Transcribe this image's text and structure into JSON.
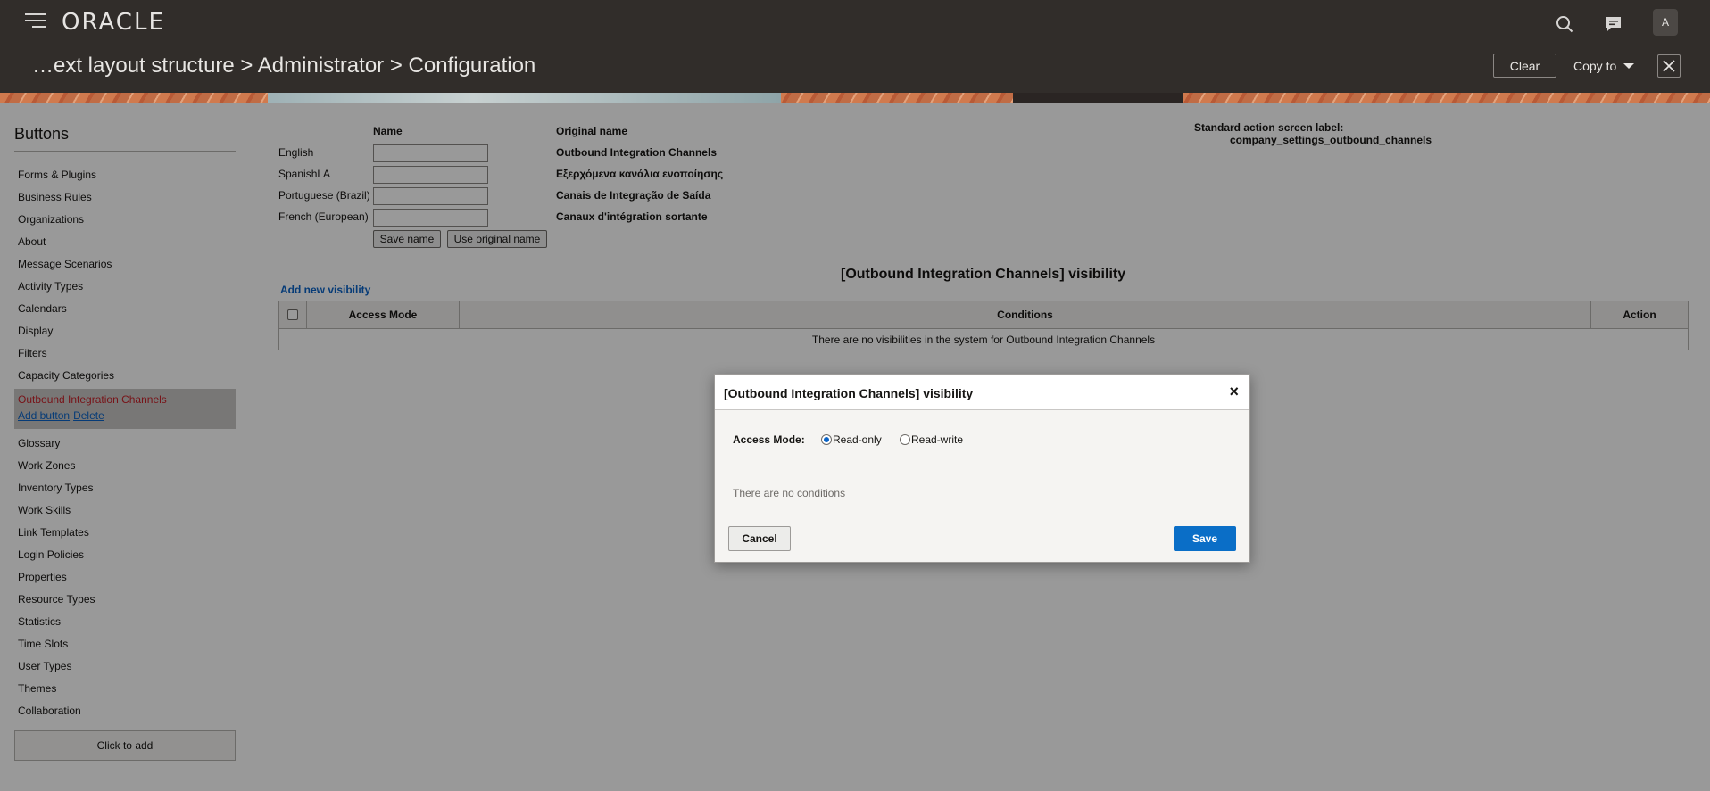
{
  "header": {
    "logo": "ORACLE",
    "breadcrumb": "…ext layout structure > Administrator > Configuration",
    "clear_label": "Clear",
    "copy_to_label": "Copy to",
    "avatar_initial": "A",
    "icons": [
      "menu-icon",
      "search-icon",
      "chat-icon",
      "close-icon"
    ]
  },
  "sidebar": {
    "title": "Buttons",
    "items_before": [
      "Forms & Plugins",
      "Business Rules",
      "Organizations",
      "About",
      "Message Scenarios",
      "Activity Types",
      "Calendars",
      "Display",
      "Filters",
      "Capacity Categories"
    ],
    "active": {
      "label": "Outbound Integration Channels",
      "add_button": "Add button",
      "delete": "Delete"
    },
    "items_after": [
      "Glossary",
      "Work Zones",
      "Inventory Types",
      "Work Skills",
      "Link Templates",
      "Login Policies",
      "Properties",
      "Resource Types",
      "Statistics",
      "Time Slots",
      "User Types",
      "Themes",
      "Collaboration"
    ],
    "click_to_add": "Click to add"
  },
  "names": {
    "name_header": "Name",
    "original_header": "Original name",
    "rows": [
      {
        "language": "English",
        "value": "",
        "original": "Outbound Integration Channels"
      },
      {
        "language": "SpanishLA",
        "value": "",
        "original": "Εξερχόμενα κανάλια ενοποίησης"
      },
      {
        "language": "Portuguese (Brazil)",
        "value": "",
        "original": "Canais de Integração de Saída"
      },
      {
        "language": "French (European)",
        "value": "",
        "original": "Canaux d'intégration sortante"
      }
    ],
    "save_name": "Save name",
    "use_original": "Use original name",
    "standard_label_caption": "Standard action screen label:",
    "standard_label_value": "company_settings_outbound_channels"
  },
  "visibility": {
    "title": "[Outbound Integration Channels] visibility",
    "add_new": "Add new visibility",
    "columns": [
      "Access Mode",
      "Conditions",
      "Action"
    ],
    "empty_message": "There are no visibilities in the system for Outbound Integration Channels"
  },
  "modal": {
    "title": "[Outbound Integration Channels] visibility",
    "access_mode_label": "Access Mode:",
    "options": [
      "Read-only",
      "Read-write"
    ],
    "selected": "Read-only",
    "no_conditions": "There are no conditions",
    "cancel": "Cancel",
    "save": "Save",
    "close_glyph": "×"
  },
  "colors": {
    "header_bg": "#312d2a",
    "active_item": "#c7222a",
    "link": "#0a63c7",
    "primary_button": "#0a6ec7"
  }
}
